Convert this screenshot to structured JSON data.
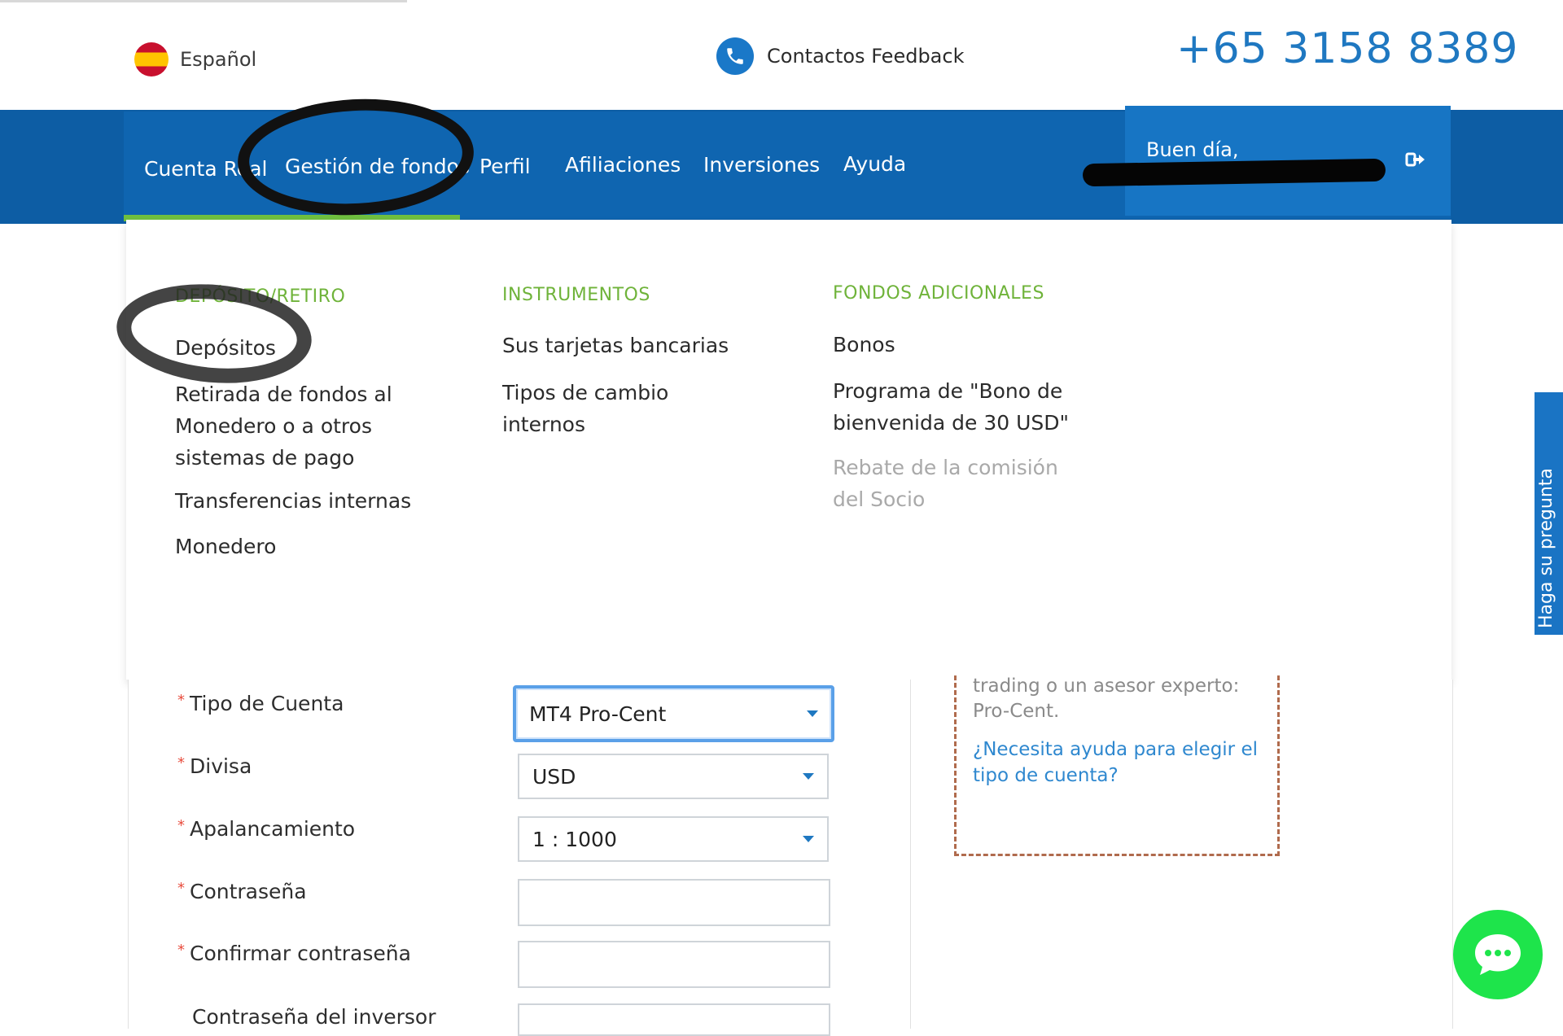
{
  "header": {
    "language": "Español",
    "contact_label": "Contactos Feedback",
    "phone_number": "+65 3158 8389"
  },
  "nav": {
    "items": [
      {
        "label": "Cuenta Real"
      },
      {
        "label": "Gestión de fondos"
      },
      {
        "label": "Perfil"
      },
      {
        "label": "Afiliaciones"
      },
      {
        "label": "Inversiones"
      },
      {
        "label": "Ayuda"
      }
    ],
    "greeting": "Buen día,"
  },
  "dropdown": {
    "col1": {
      "heading": "DEPÓSITO/RETIRO",
      "items": [
        "Depósitos",
        "Retirada de fondos al Monedero o a otros sistemas de pago",
        "Transferencias internas",
        "Monedero"
      ]
    },
    "col2": {
      "heading": "INSTRUMENTOS",
      "items": [
        "Sus tarjetas bancarias",
        "Tipos de cambio internos"
      ]
    },
    "col3": {
      "heading": "FONDOS ADICIONALES",
      "items": [
        "Bonos",
        "Programa de \"Bono de bienvenida de 30 USD\"",
        "Rebate de la comisión del Socio"
      ]
    }
  },
  "form": {
    "account_type_label": "Tipo de Cuenta",
    "account_type_value": "MT4 Pro-Cent",
    "currency_label": "Divisa",
    "currency_value": "USD",
    "leverage_label": "Apalancamiento",
    "leverage_value": "1 : 1000",
    "password_label": "Contraseña",
    "confirm_password_label": "Confirmar contraseña",
    "investor_password_label": "Contraseña del inversor",
    "required_mark": "*"
  },
  "help": {
    "text": "trading o un asesor experto: Pro-Cent.",
    "link": "¿Necesita ayuda para elegir el tipo de cuenta?"
  },
  "side_tab": {
    "label": "Haga su pregunta"
  },
  "colors": {
    "nav_blue": "#0d5da4",
    "accent_green": "#6fbf3f",
    "link_blue": "#1f78c1",
    "chat_green": "#1ee44b"
  }
}
